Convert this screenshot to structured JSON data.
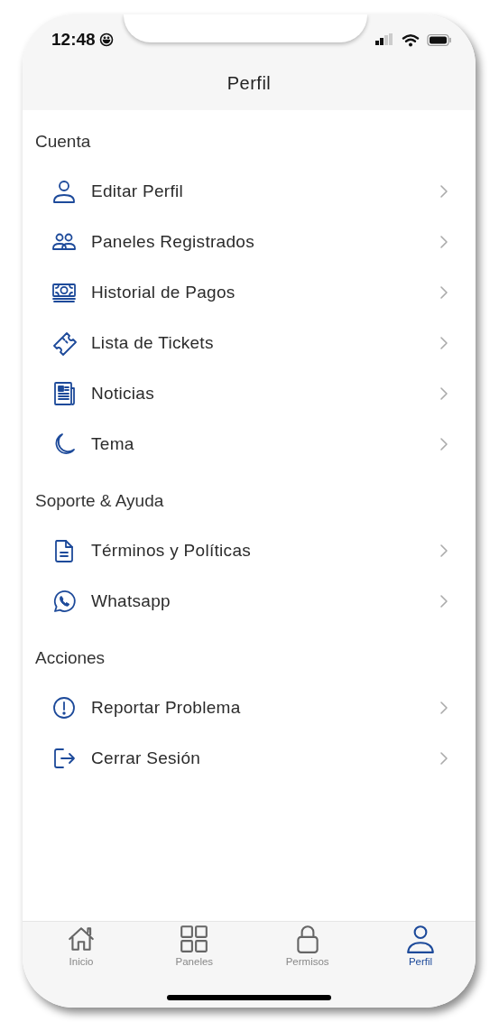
{
  "status_bar": {
    "time": "12:48"
  },
  "header": {
    "title": "Perfil"
  },
  "sections": [
    {
      "title": "Cuenta",
      "items": [
        {
          "label": "Editar Perfil"
        },
        {
          "label": "Paneles Registrados"
        },
        {
          "label": "Historial de Pagos"
        },
        {
          "label": "Lista de Tickets"
        },
        {
          "label": "Noticias"
        },
        {
          "label": "Tema"
        }
      ]
    },
    {
      "title": "Soporte & Ayuda",
      "items": [
        {
          "label": "Términos y Políticas"
        },
        {
          "label": "Whatsapp"
        }
      ]
    },
    {
      "title": "Acciones",
      "items": [
        {
          "label": "Reportar Problema"
        },
        {
          "label": "Cerrar Sesión"
        }
      ]
    }
  ],
  "tab_bar": [
    {
      "label": "Inicio",
      "selected": false
    },
    {
      "label": "Paneles",
      "selected": false
    },
    {
      "label": "Permisos",
      "selected": false
    },
    {
      "label": "Perfil",
      "selected": true
    }
  ]
}
